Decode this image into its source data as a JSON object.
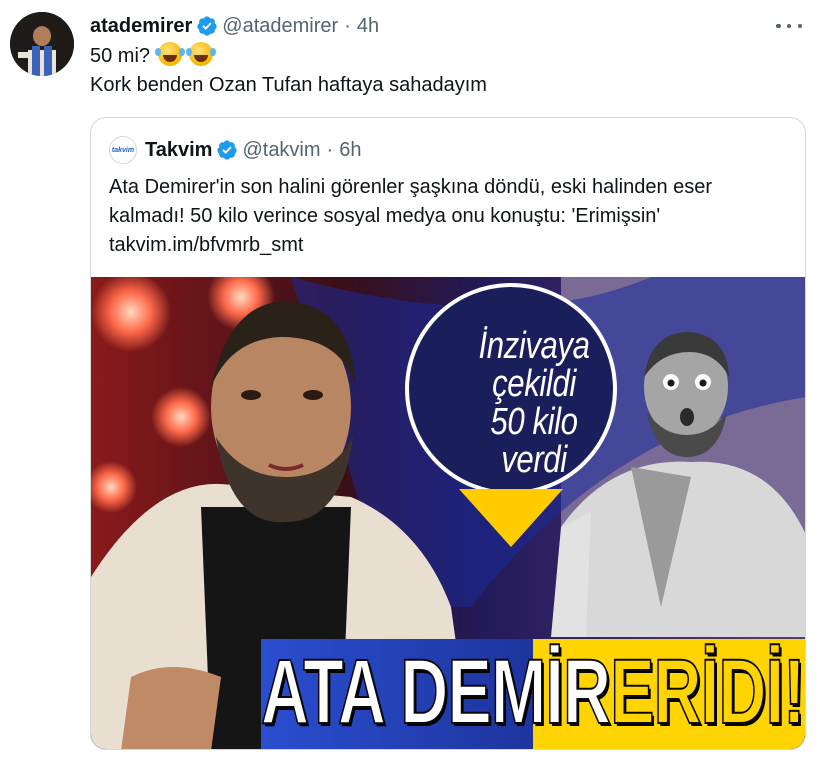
{
  "tweet": {
    "author_name": "atademirer",
    "author_handle": "@atademirer",
    "separator": "·",
    "time": "4h",
    "line1": "50 mi?",
    "line2": "Kork benden Ozan Tufan haftaya sahadayım",
    "emojis": [
      "face-with-tears-of-joy-icon",
      "face-with-tears-of-joy-icon"
    ]
  },
  "quoted": {
    "author_name": "Takvim",
    "avatar_text": "takvim",
    "author_handle": "@takvim",
    "separator": "·",
    "time": "6h",
    "text_line1": "Ata Demirer'in son halini görenler şaşkına döndü, eski halinden eser",
    "text_line2": "kalmadı! 50 kilo verince sosyal medya onu konuştu: 'Erimişsin'",
    "link": "takvim.im/bfvmrb_smt",
    "image": {
      "circle_line1": "İnzivaya",
      "circle_line2": "çekildi",
      "circle_line3": "50 kilo",
      "circle_line4": "verdi",
      "banner_white": "ATA DEMİR",
      "banner_yellow": "ERİDİ!"
    }
  },
  "colors": {
    "verified": "#1d9bf0",
    "secondary_text": "#536471",
    "border": "#cfd9de",
    "banner_yellow": "#ffd400",
    "circle_navy": "#1a1f5c"
  }
}
